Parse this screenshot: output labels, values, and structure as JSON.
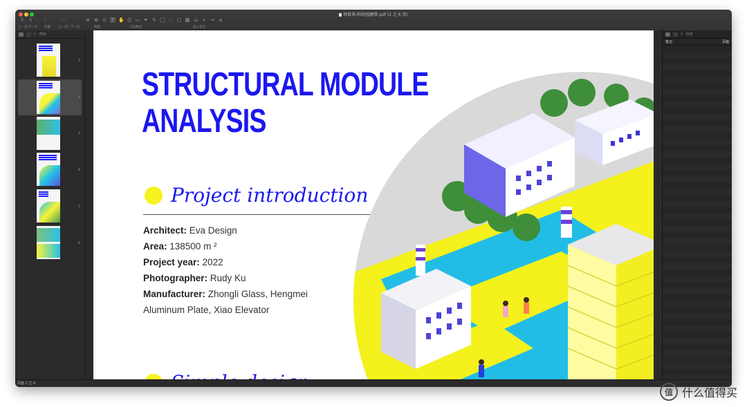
{
  "window": {
    "title": "项目海-科技园建筑.pdf (2 之 6 页)",
    "traffic_colors": [
      "#ff5f57",
      "#febc2e",
      "#28c840"
    ]
  },
  "toolbar": {
    "labels": {
      "prev_next": "上一页/下一页",
      "page": "页面",
      "prev_next_2": "上一页 / 下一页",
      "zoom": "缩放",
      "tool_mode": "工具模式",
      "insert_note": "插入笔记"
    }
  },
  "sidebar": {
    "search_placeholder": "搜索",
    "thumbnails": [
      {
        "number": "1"
      },
      {
        "number": "2",
        "selected": true
      },
      {
        "number": "3"
      },
      {
        "number": "4"
      },
      {
        "number": "5"
      },
      {
        "number": "6"
      }
    ]
  },
  "page": {
    "heading_line1": "STRUCTURAL MODULE",
    "heading_line2": "ANALYSIS",
    "section1_title": "Project introduction",
    "section2_title": "Simple design",
    "info": [
      {
        "label": "Architect:",
        "value": " Eva Design"
      },
      {
        "label": "Area:",
        "value": " 138500 m ²"
      },
      {
        "label": "Project year:",
        "value": " 2022"
      },
      {
        "label": "Photographer:",
        "value": " Rudy Ku"
      },
      {
        "label": "Manufacturer:",
        "value": " Zhongli Glass, Hengmei"
      }
    ],
    "info_continuation": "Aluminum Plate, Xiao Elevator",
    "colors": {
      "accent_blue": "#1b17f0",
      "accent_yellow": "#f6f21d"
    }
  },
  "notes": {
    "search_placeholder": "搜索",
    "header_left": "笔记",
    "header_right": "页面"
  },
  "status": {
    "text": "页面 2 之 6"
  },
  "watermark": {
    "text": "什么值得买",
    "icon_char": "值"
  }
}
